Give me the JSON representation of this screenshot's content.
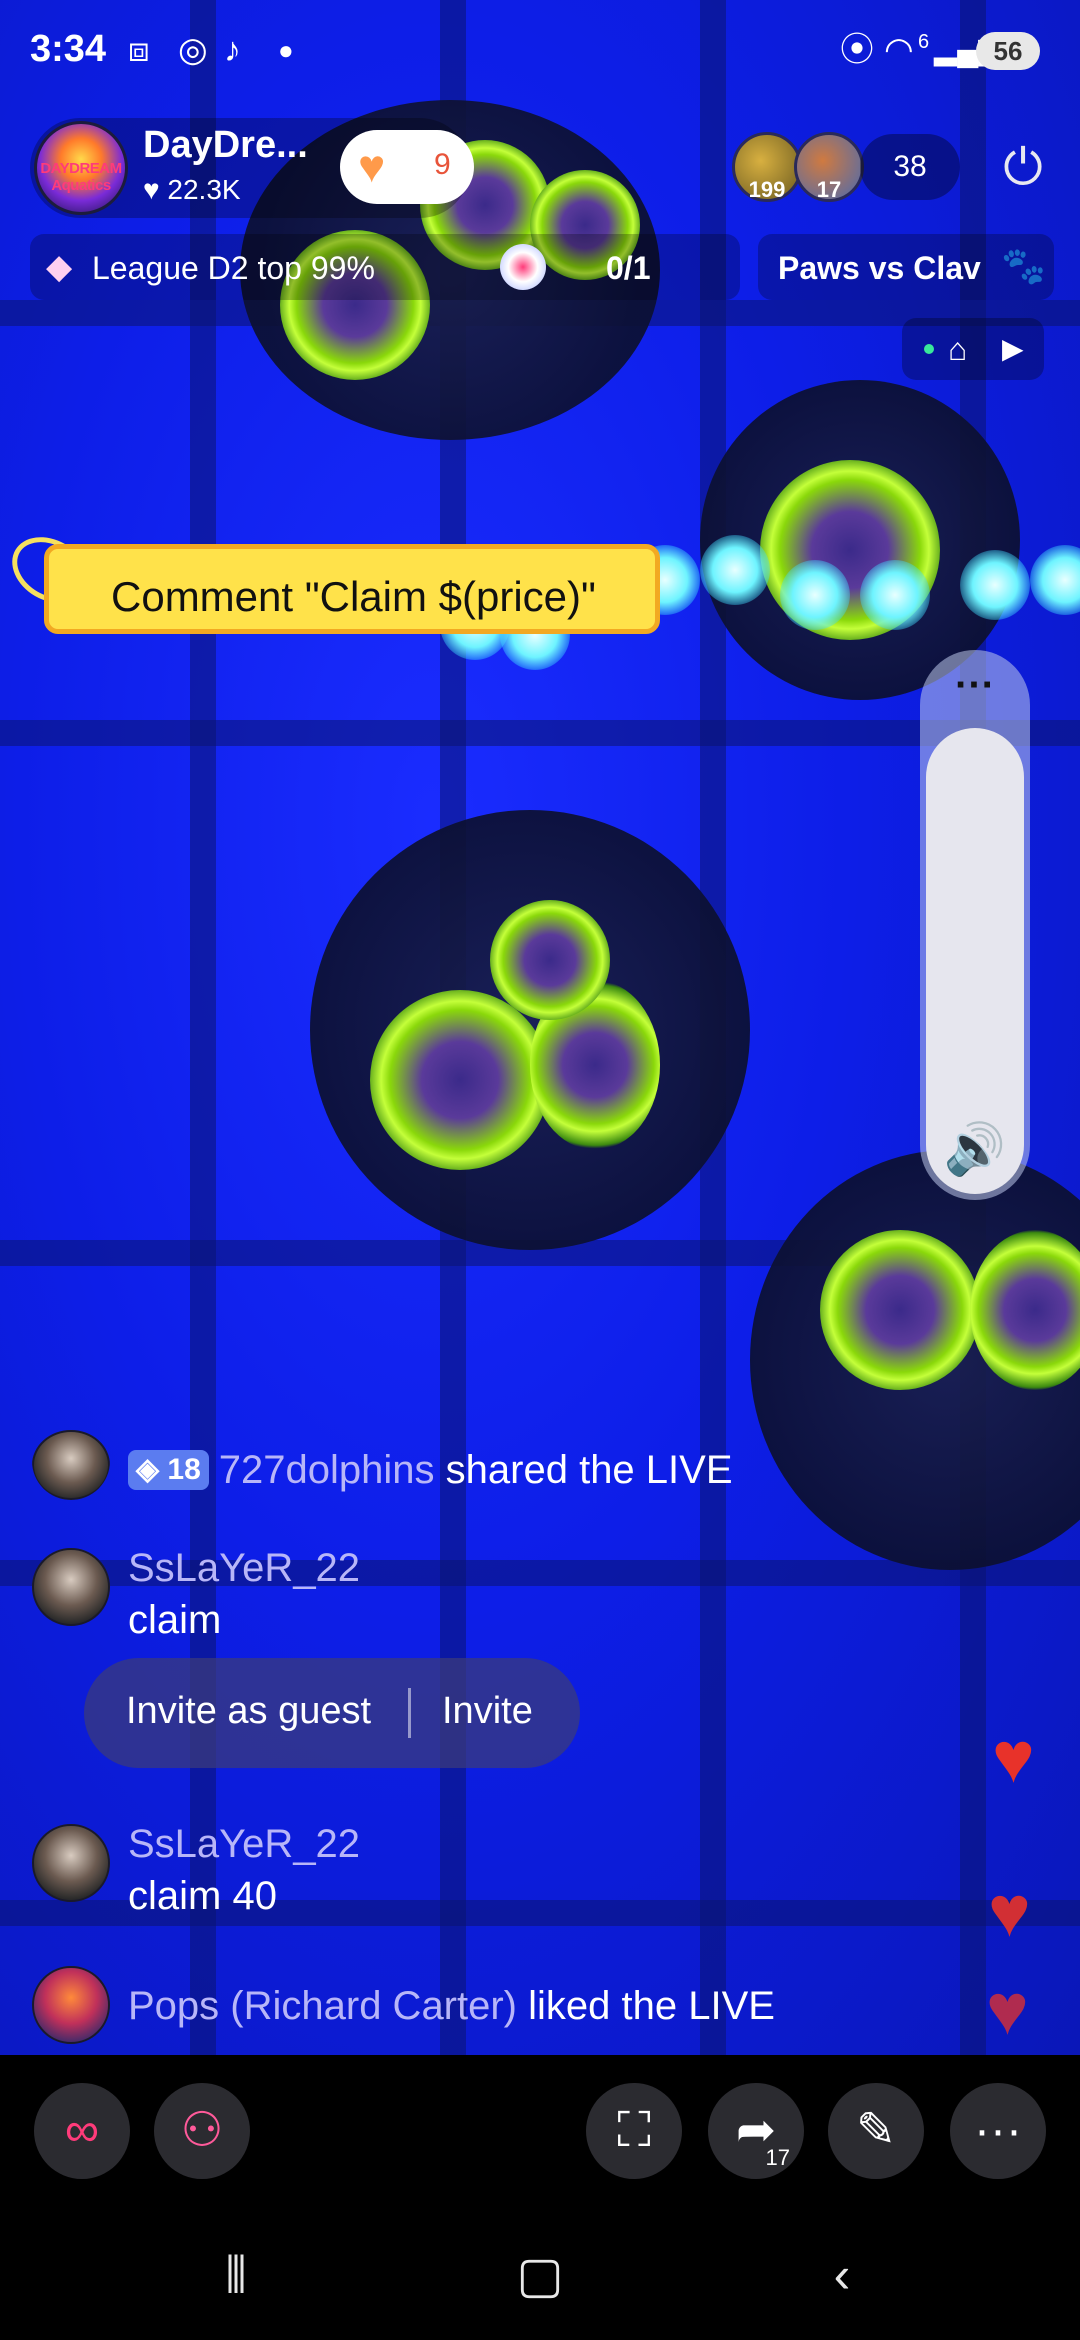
{
  "status_bar": {
    "time": "3:34",
    "left_icons": [
      "screen-capture-icon",
      "instagram-icon",
      "tiktok-icon",
      "dot-icon"
    ],
    "right_icons": [
      "location-icon",
      "wifi-icon",
      "signal-icon"
    ],
    "wifi_label": "6",
    "battery": "56"
  },
  "host": {
    "avatar_text": "DAYDREAM Aquatics",
    "name": "DayDre...",
    "likes": "22.3K",
    "heart_count": "9"
  },
  "viewers": {
    "avatars": [
      {
        "badge": "199"
      },
      {
        "badge": "17"
      }
    ],
    "count": "38"
  },
  "league": {
    "label": "League D2 top 99%",
    "progress": "0/1"
  },
  "battle": {
    "label": "Paws vs Clav"
  },
  "sticker": {
    "text": "Comment \"Claim $(price)\""
  },
  "volume": {
    "level": 1.0,
    "menu_icon": "more-dots-icon",
    "icon": "speaker-icon"
  },
  "chat": [
    {
      "type": "event",
      "level": "18",
      "user": "727dolphins",
      "action": "shared the LIVE"
    },
    {
      "type": "comment",
      "user": "SsLaYeR_22",
      "message": "claim"
    },
    {
      "type": "comment",
      "user": "SsLaYeR_22",
      "message": "claim 40"
    },
    {
      "type": "event",
      "user": "Pops (Richard Carter)",
      "action": "liked the LIVE"
    }
  ],
  "invite": {
    "guest_label": "Invite as guest",
    "invite_label": "Invite"
  },
  "toolbar": {
    "buttons": [
      "link-icon",
      "people-icon",
      "shopping-bag-icon",
      "share-icon",
      "magic-wand-icon",
      "more-icon"
    ],
    "share_count": "17"
  },
  "nav": [
    "recents-icon",
    "home-icon",
    "back-icon"
  ],
  "colors": {
    "username": "#b8b6f8",
    "sticker_bg": "#ffe24a",
    "heart": "#e8322a",
    "accent_pink": "#ff3b7a"
  }
}
